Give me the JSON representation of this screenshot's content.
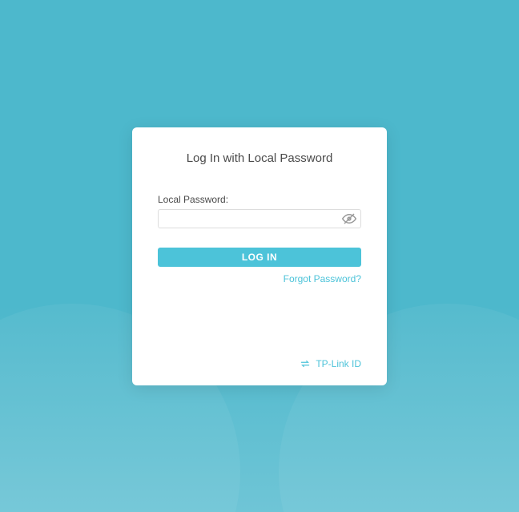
{
  "title": "Log In with Local Password",
  "password": {
    "label": "Local Password:",
    "value": ""
  },
  "login_button_label": "LOG IN",
  "forgot_password_label": "Forgot Password?",
  "tplink_id_label": "TP-Link ID"
}
